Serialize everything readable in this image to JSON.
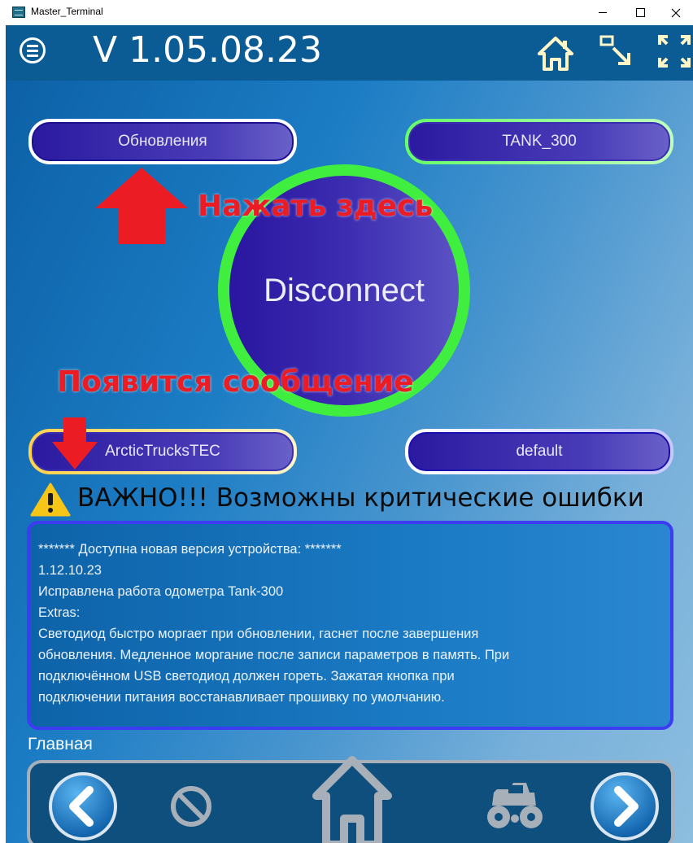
{
  "window": {
    "title": "Master_Terminal"
  },
  "header": {
    "version": "V 1.05.08.23",
    "icons": [
      "menu-icon",
      "home-icon",
      "resize-icon",
      "fullscreen-icon"
    ]
  },
  "buttons": {
    "updates": "Обновления",
    "device": "TANK_300",
    "disconnect": "Disconnect",
    "company": "ArcticTrucksTEC",
    "profile": "default"
  },
  "annotations": {
    "press_here": "Нажать здесь",
    "message_appears": "Появится сообщение"
  },
  "warning": {
    "text": "ВАЖНО!!! Возможны критические ошибки"
  },
  "message": {
    "lines": [
      "******* Доступна новая версия устройства: *******",
      "1.12.10.23",
      "Исправлена работа одометра Tank-300",
      "Extras:",
      "Светодиод быстро моргает при обновлении, гаснет после завершения",
      "обновления. Медленное моргание после записи параметров в память. При",
      "подключённом USB светодиод должен гореть. Зажатая кнопка при",
      "подключении питания восстанавливает прошивку по умолчанию."
    ]
  },
  "nav": {
    "label": "Главная",
    "items": [
      "back-icon",
      "block-icon",
      "home-icon",
      "vehicle-icon",
      "forward-icon"
    ]
  },
  "colors": {
    "accent_red": "#ec1c24",
    "ring_green": "#40ee40",
    "header_bg": "#0b5c95",
    "nav_bg": "#0f4f7e"
  }
}
